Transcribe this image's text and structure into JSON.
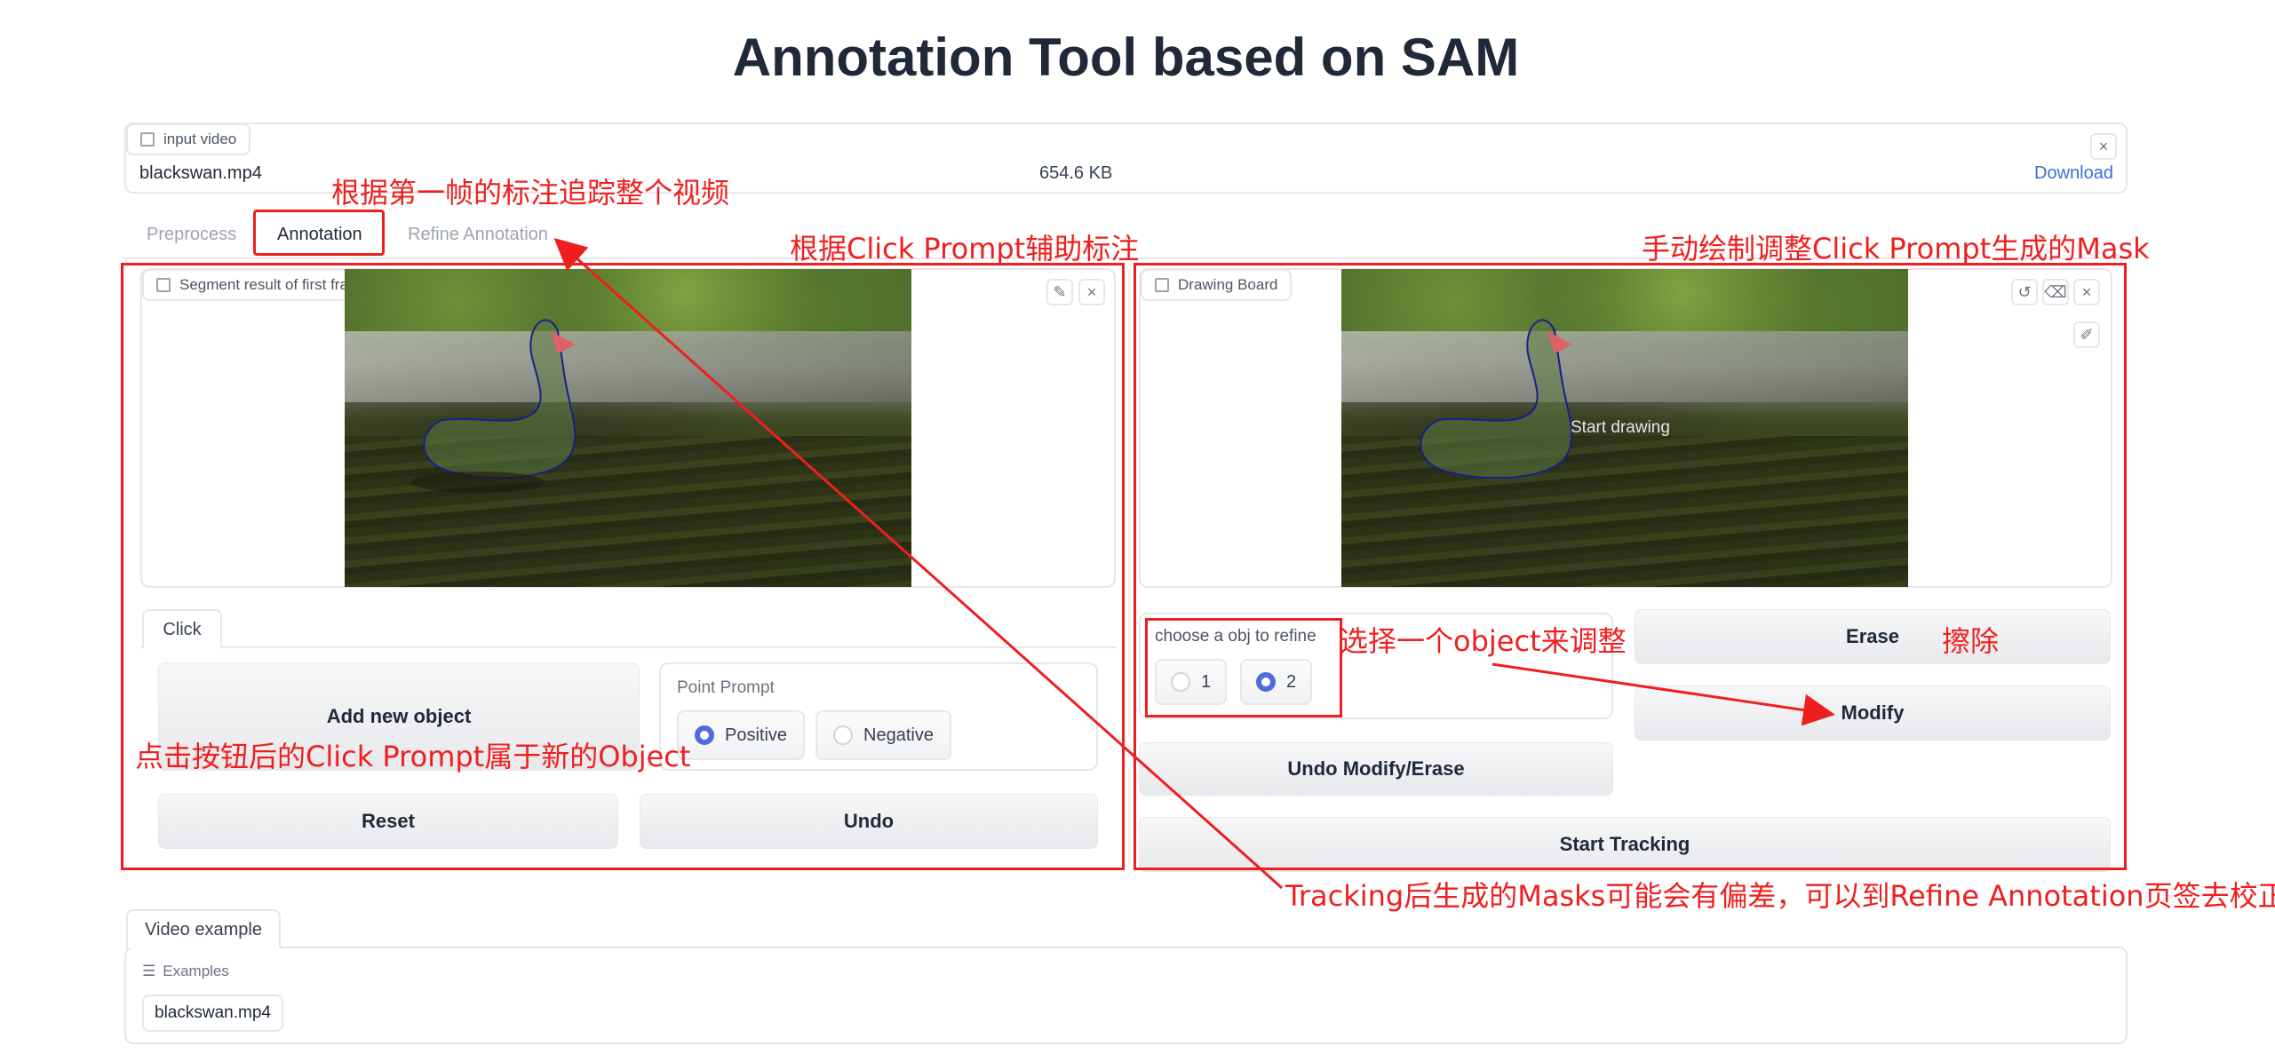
{
  "app": {
    "title": "Annotation Tool based on SAM"
  },
  "file_input": {
    "chip_label": "input video",
    "file_name": "blackswan.mp4",
    "file_size": "654.6 KB",
    "download_label": "Download",
    "close_symbol": "×"
  },
  "tabs": [
    {
      "label": "Preprocess",
      "active": false
    },
    {
      "label": "Annotation",
      "active": true
    },
    {
      "label": "Refine Annotation",
      "active": false
    }
  ],
  "left_panel": {
    "image_chip": "Segment result of first frame",
    "edit_symbol": "✎",
    "close_symbol": "×",
    "click_tab": "Click",
    "add_object_button": "Add new object",
    "point_prompt": {
      "label": "Point Prompt",
      "options": [
        {
          "label": "Positive",
          "selected": true
        },
        {
          "label": "Negative",
          "selected": false
        }
      ]
    },
    "reset_button": "Reset",
    "undo_button": "Undo"
  },
  "right_panel": {
    "image_chip": "Drawing Board",
    "start_drawing": "Start drawing",
    "undo_symbol": "↺",
    "eraser_symbol": "⌫",
    "close_symbol": "×",
    "brush_symbol": "✐",
    "obj_select": {
      "label": "choose a obj to refine",
      "options": [
        {
          "label": "1",
          "selected": false
        },
        {
          "label": "2",
          "selected": true
        }
      ]
    },
    "erase_button": "Erase",
    "modify_button": "Modify",
    "undo_modify_button": "Undo Modify/Erase",
    "start_tracking_button": "Start Tracking"
  },
  "examples": {
    "tab": "Video example",
    "label": "Examples",
    "items": [
      "blackswan.mp4"
    ]
  },
  "annotations": {
    "track_whole_video": "根据第一帧的标注追踪整个视频",
    "click_prompt_assist": "根据Click Prompt辅助标注",
    "manual_draw": "手动绘制调整Click Prompt生成的Mask",
    "choose_object": "选择一个object来调整",
    "erase": "擦除",
    "new_object_note": "点击按钮后的Click Prompt属于新的Object",
    "tracking_note": "Tracking后生成的Masks可能会有偏差，可以到Refine Annotation页签去校正"
  },
  "colors": {
    "annotation_red": "#ef1f1f",
    "radio_blue": "#4f6bd8",
    "link_blue": "#3b6fd8"
  }
}
